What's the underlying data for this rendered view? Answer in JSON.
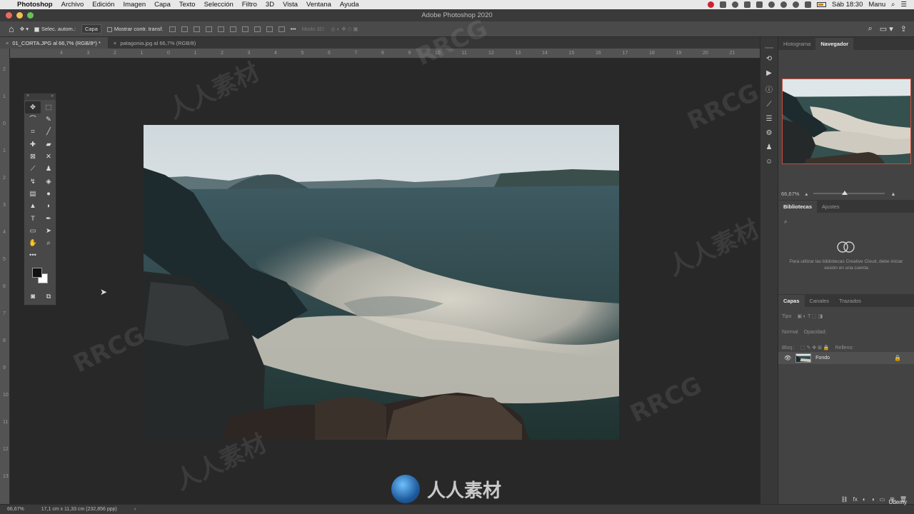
{
  "menubar": {
    "app": "Photoshop",
    "items": [
      "Archivo",
      "Edición",
      "Imagen",
      "Capa",
      "Texto",
      "Selección",
      "Filtro",
      "3D",
      "Vista",
      "Ventana",
      "Ayuda"
    ],
    "clock": "Sáb 18:30",
    "user": "Manu"
  },
  "window": {
    "title": "Adobe Photoshop 2020"
  },
  "options": {
    "auto_select_label": "Selec. autom.:",
    "auto_select_value": "Capa",
    "show_transform": "Mostrar contr. transf.",
    "mode_3d": "Modo 3D:"
  },
  "tabs": [
    {
      "label": "01_CORTA.JPG al 66,7% (RGB/8*) *",
      "active": true
    },
    {
      "label": "patagonia.jpg al 66,7% (RGB/8)",
      "active": false
    }
  ],
  "ruler": {
    "h_labels": [
      "4",
      "3",
      "2",
      "1",
      "0",
      "1",
      "2",
      "3",
      "4",
      "5",
      "6",
      "7",
      "8",
      "9",
      "10",
      "11",
      "12",
      "13",
      "14",
      "15",
      "16",
      "17",
      "18",
      "19",
      "20",
      "21"
    ],
    "v_labels": [
      "2",
      "1",
      "0",
      "1",
      "2",
      "3",
      "4",
      "5",
      "6",
      "7",
      "8",
      "9",
      "10",
      "11",
      "12",
      "13"
    ]
  },
  "panels": {
    "top_tabs": [
      "Histograma",
      "Navegador"
    ],
    "zoom": "66,67%",
    "lib_tabs": [
      "Bibliotecas",
      "Ajustes"
    ],
    "lib_message": "Para utilizar las bibliotecas Creative Cloud, debe iniciar sesión en una cuenta",
    "layer_tabs": [
      "Capas",
      "Canales",
      "Trazados"
    ],
    "filter_label": "Tipo",
    "blend_mode": "Normal",
    "opacity_label": "Opacidad:",
    "lock_label": "Bloq.:",
    "fill_label": "Relleno:",
    "layer_name": "Fondo"
  },
  "status": {
    "zoom": "66,67%",
    "doc_info": "17,1 cm x 11,33 cm (232,856 ppp)"
  },
  "watermarks": {
    "text": "RRCG",
    "cn_text": "人人素材",
    "udemy": "Udemy"
  }
}
